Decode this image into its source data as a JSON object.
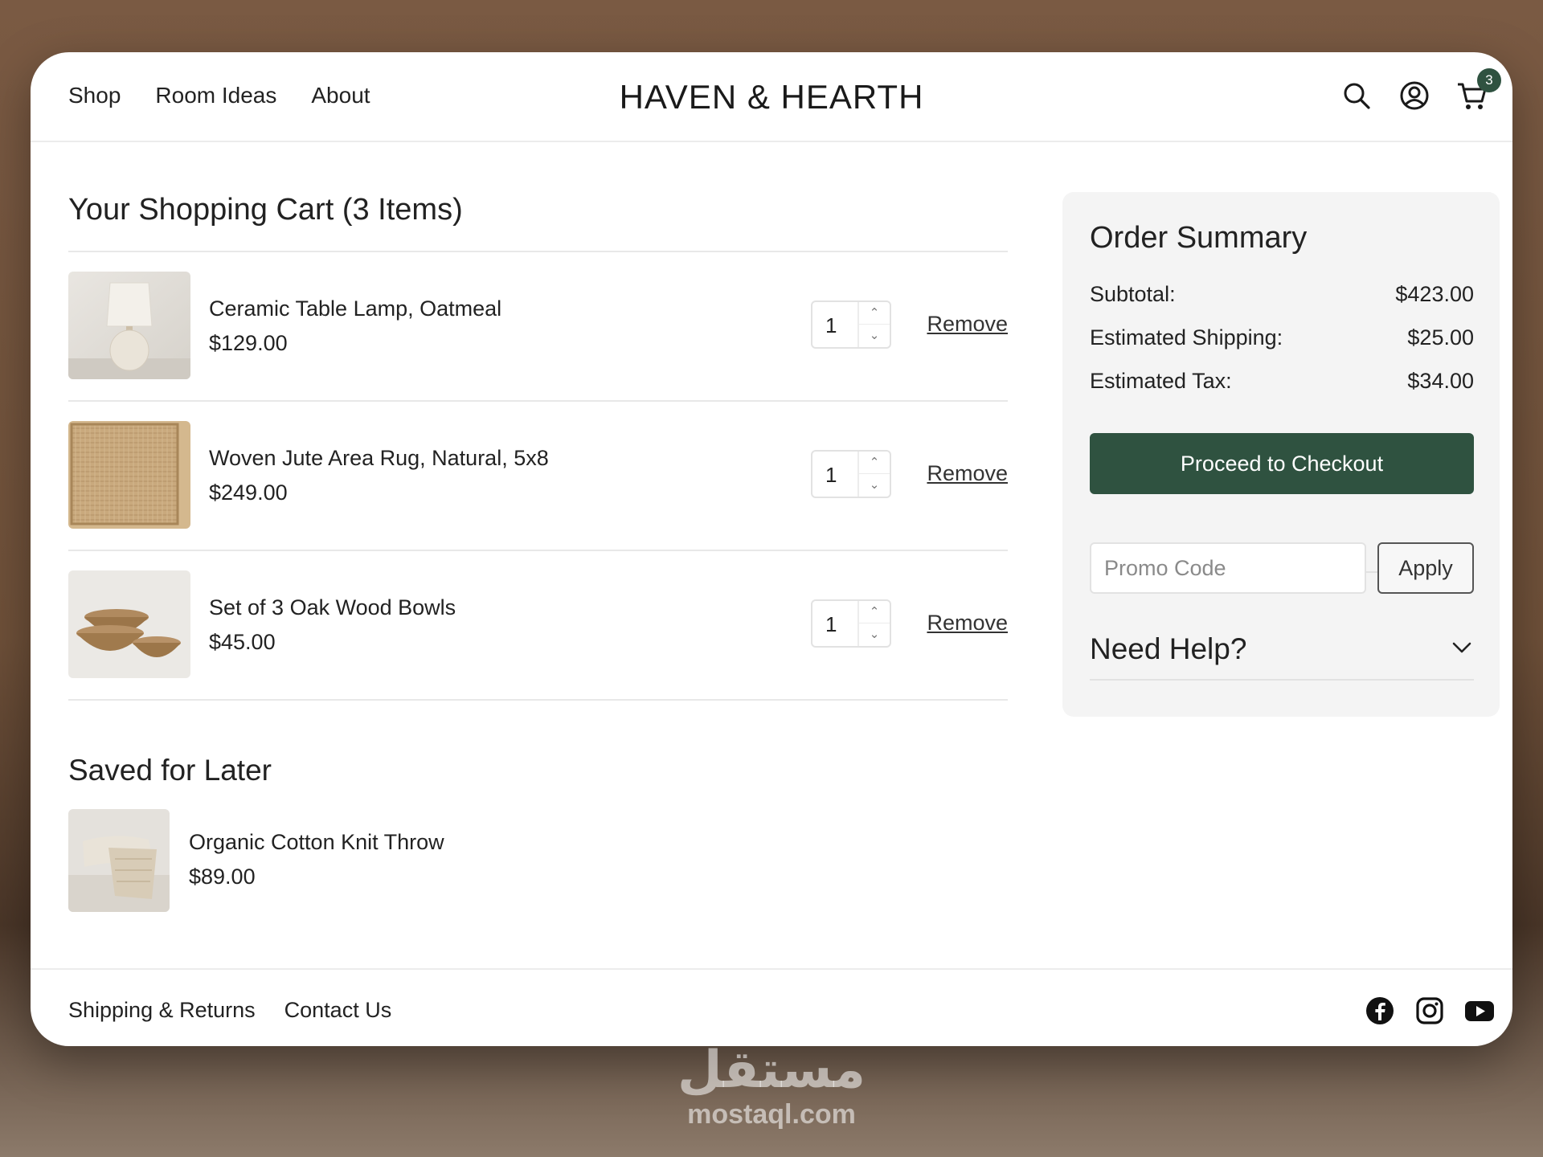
{
  "header": {
    "nav": [
      "Shop",
      "Room Ideas",
      "About"
    ],
    "brand": "HAVEN & HEARTH",
    "cart_count": "3",
    "icons": [
      "search-icon",
      "account-icon",
      "cart-icon"
    ]
  },
  "cart": {
    "title": "Your Shopping Cart (3 Items)",
    "items": [
      {
        "name": "Ceramic Table Lamp, Oatmeal",
        "price": "$129.00",
        "qty": "1",
        "remove": "Remove"
      },
      {
        "name": "Woven Jute Area Rug, Natural, 5x8",
        "price": "$249.00",
        "qty": "1",
        "remove": "Remove"
      },
      {
        "name": "Set of 3 Oak Wood Bowls",
        "price": "$45.00",
        "qty": "1",
        "remove": "Remove"
      }
    ]
  },
  "saved": {
    "title": "Saved for Later",
    "items": [
      {
        "name": "Organic Cotton Knit Throw",
        "price": "$89.00"
      }
    ]
  },
  "summary": {
    "title": "Order Summary",
    "subtotal_label": "Subtotal:",
    "subtotal": "$423.00",
    "shipping_label": "Estimated Shipping:",
    "shipping": "$25.00",
    "tax_label": "Estimated Tax:",
    "tax": "$34.00",
    "checkout": "Proceed to Checkout",
    "promo_placeholder": "Promo Code",
    "apply": "Apply",
    "help": "Need Help?"
  },
  "footer": {
    "links": [
      "Shipping & Returns",
      "Contact Us"
    ],
    "social": [
      "facebook-icon",
      "instagram-icon",
      "youtube-icon"
    ]
  },
  "watermark": {
    "arabic": "مستقل",
    "latin": "mostaql.com"
  },
  "colors": {
    "accent": "#2f5240",
    "background": "#7a5a43"
  }
}
